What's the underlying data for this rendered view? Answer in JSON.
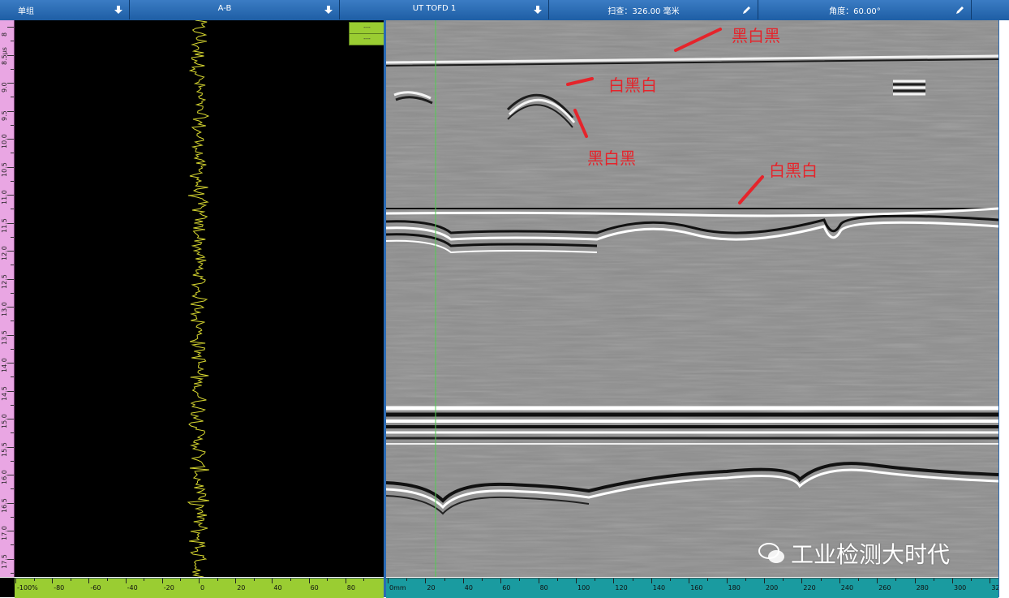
{
  "toolbar": {
    "group_label": "单组",
    "view_label": "A-B",
    "channel_label": "UT TOFD 1",
    "scan_label": "扫查：326.00 毫米",
    "angle_label": "角度：60.00°"
  },
  "markers": {
    "top": "---",
    "bottom": "---"
  },
  "vertical_scale": {
    "unit": "μs",
    "ticks": [
      "8",
      "8.5",
      "9.0",
      "9.5",
      "10.0",
      "10.5",
      "11.0",
      "11.5",
      "12.0",
      "12.5",
      "13.0",
      "13.5",
      "14.0",
      "14.5",
      "15.0",
      "15.5",
      "16.0",
      "16.5",
      "17.0",
      "17.5"
    ]
  },
  "ascan_scale": {
    "ticks": [
      "-100%",
      "-80",
      "-60",
      "-40",
      "-20",
      "0",
      "20",
      "40",
      "60",
      "80"
    ]
  },
  "bscan_scale": {
    "ticks": [
      "0mm",
      "20",
      "40",
      "60",
      "80",
      "100",
      "120",
      "140",
      "160",
      "180",
      "200",
      "220",
      "240",
      "260",
      "280",
      "300",
      "320"
    ]
  },
  "annotations": {
    "a1": "黑白黑",
    "a2": "白黑白",
    "a3": "黑白黑",
    "a4": "白黑白"
  },
  "watermark": "工业检测大时代",
  "colors": {
    "toolbar": "#1f5fa6",
    "ascan_background": "#000000",
    "ascan_signal": "#d8d830",
    "cursor": "#50d050",
    "annotation": "#e5242b",
    "scale_green": "#9acd32",
    "scale_teal": "#1a9ba0",
    "scale_pink": "#e9a6e3"
  },
  "icons": {
    "dropdown": "arrow-down-icon",
    "edit": "pencil-icon"
  }
}
